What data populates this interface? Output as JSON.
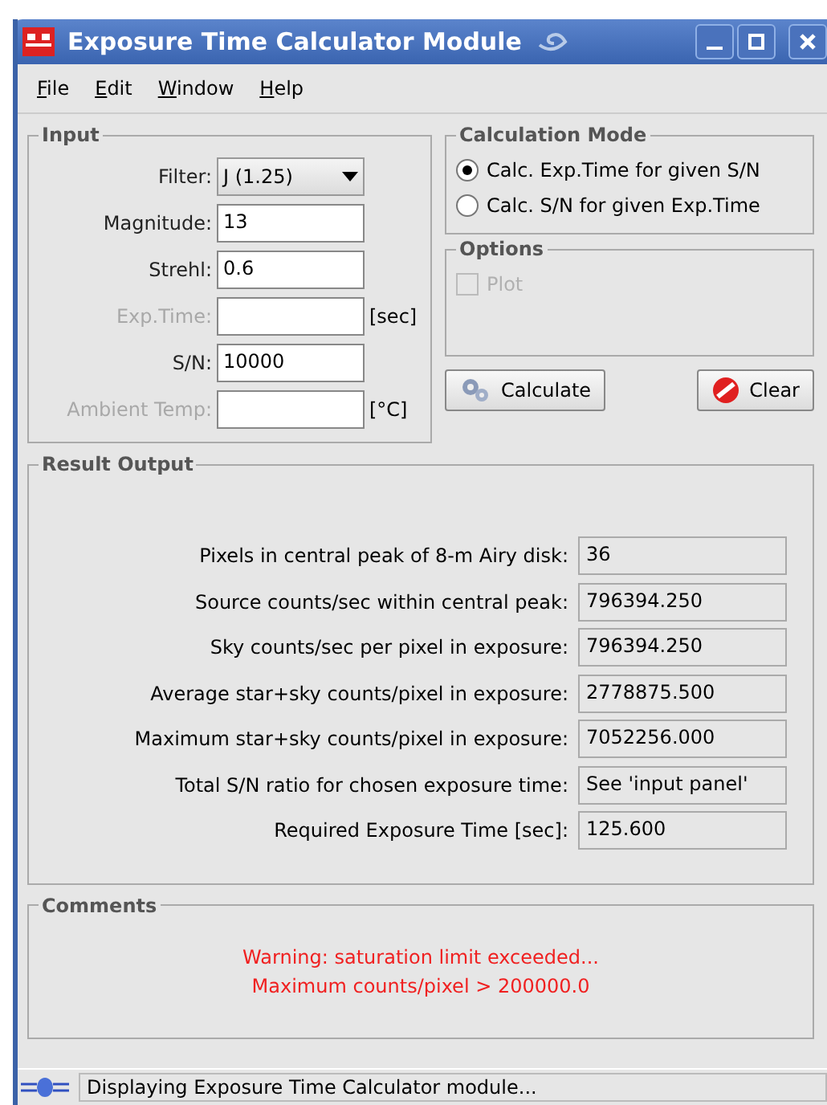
{
  "window": {
    "title": "Exposure Time Calculator Module"
  },
  "menu": [
    "File",
    "Edit",
    "Window",
    "Help"
  ],
  "input": {
    "title": "Input",
    "fields": [
      {
        "kind": "select",
        "label": "Filter:",
        "value": "J (1.25)",
        "disabled": false
      },
      {
        "kind": "text",
        "label": "Magnitude:",
        "value": "13",
        "disabled": false
      },
      {
        "kind": "text",
        "label": "Strehl:",
        "value": "0.6",
        "disabled": false
      },
      {
        "kind": "text",
        "label": "Exp.Time:",
        "unit": "[sec]",
        "disabled": true
      },
      {
        "kind": "text",
        "label": "S/N:",
        "value": "10000",
        "disabled": false
      },
      {
        "kind": "text",
        "label": "Ambient Temp:",
        "unit": "[°C]",
        "disabled": true
      }
    ]
  },
  "calculation_mode": {
    "title": "Calculation Mode",
    "options": [
      {
        "label": "Calc. Exp.Time for given S/N",
        "selected": true
      },
      {
        "label": "Calc. S/N for given Exp.Time",
        "selected": false
      }
    ]
  },
  "options": {
    "title": "Options",
    "items": [
      {
        "label": "Plot",
        "checked": false,
        "disabled": true
      }
    ]
  },
  "buttons": [
    {
      "kind": "calculate",
      "label": "Calculate"
    },
    {
      "kind": "clear",
      "label": "Clear"
    }
  ],
  "result_output": {
    "title": "Result Output",
    "rows": [
      {
        "label": "Pixels in central peak of 8-m Airy disk:",
        "value": "36"
      },
      {
        "label": "Source counts/sec within central peak:",
        "value": "796394.250"
      },
      {
        "label": "Sky counts/sec per pixel in exposure:",
        "value": "796394.250"
      },
      {
        "label": "Average star+sky counts/pixel in exposure:",
        "value": "2778875.500"
      },
      {
        "label": "Maximum star+sky counts/pixel in exposure:",
        "value": "7052256.000"
      },
      {
        "label": "Total S/N ratio for chosen exposure time:",
        "value": "See 'input panel'"
      },
      {
        "label": "Required Exposure Time [sec]:",
        "value": "125.600"
      }
    ]
  },
  "comments": {
    "title": "Comments",
    "lines": [
      "Warning: saturation limit exceeded...",
      "Maximum counts/pixel > 200000.0"
    ]
  },
  "status_bar": {
    "text": "Displaying Exposure Time Calculator module..."
  }
}
